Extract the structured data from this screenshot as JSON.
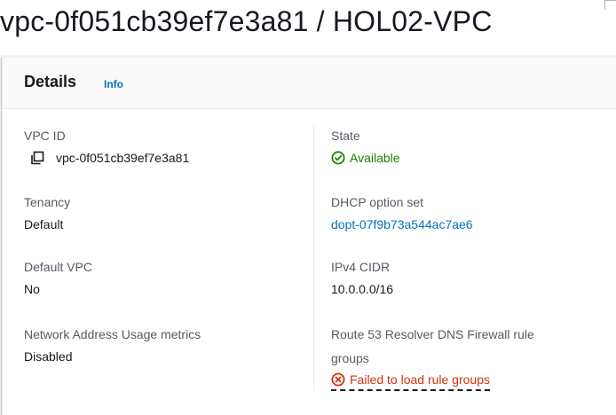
{
  "header": {
    "title": "vpc-0f051cb39ef7e3a81 / HOL02-VPC"
  },
  "details": {
    "title": "Details",
    "info_label": "Info",
    "left": {
      "vpc_id_label": "VPC ID",
      "vpc_id_value": "vpc-0f051cb39ef7e3a81",
      "tenancy_label": "Tenancy",
      "tenancy_value": "Default",
      "default_vpc_label": "Default VPC",
      "default_vpc_value": "No",
      "nau_label": "Network Address Usage metrics",
      "nau_value": "Disabled"
    },
    "right": {
      "state_label": "State",
      "state_value": "Available",
      "dhcp_label": "DHCP option set",
      "dhcp_value": "dopt-07f9b73a544ac7ae6",
      "cidr_label": "IPv4 CIDR",
      "cidr_value": "10.0.0.0/16",
      "route53_label_line1": "Route 53 Resolver DNS Firewall rule",
      "route53_label_line2": "groups",
      "route53_value": "Failed to load rule groups"
    }
  },
  "colors": {
    "link": "#0073bb",
    "success": "#1d8102",
    "error": "#d13212"
  },
  "icons": {
    "copy": "copy-icon",
    "status_ok": "status-positive-icon",
    "status_error": "status-negative-icon"
  }
}
